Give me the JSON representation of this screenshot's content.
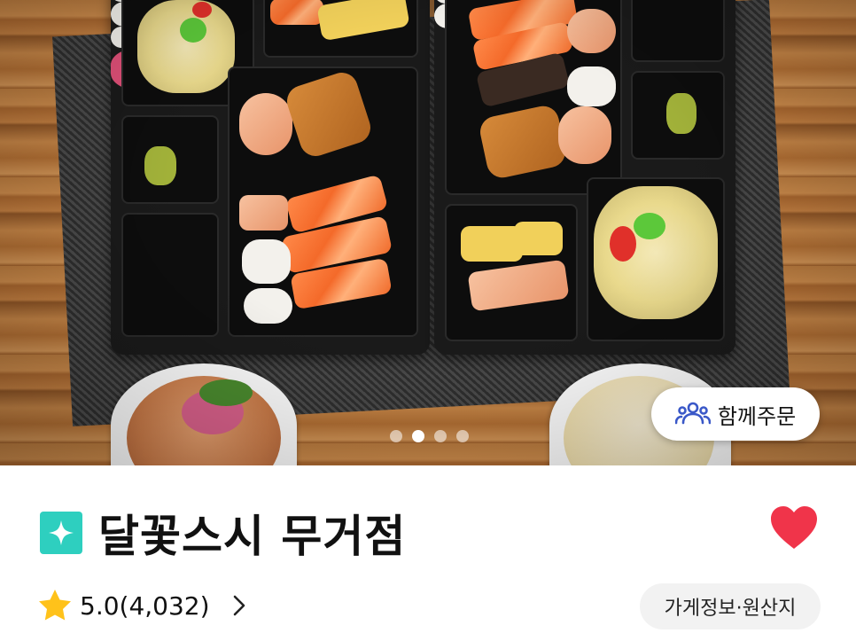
{
  "hero": {
    "carousel": {
      "total": 4,
      "active_index": 1
    },
    "together_order_label": "함께주문"
  },
  "store": {
    "name": "달꽃스시 무거점",
    "favorited": true,
    "rating_label": "5.0(4,032)",
    "info_button_label": "가게정보·원산지"
  },
  "colors": {
    "badge": "#2ecfbf",
    "heart": "#f0344a",
    "star": "#ffc21a",
    "together_icon": "#3a58c8"
  },
  "icons": {
    "together": "people-group-icon",
    "badge": "sparkle-icon",
    "favorite": "heart-icon",
    "rating": "star-icon",
    "more": "chevron-right-icon"
  }
}
